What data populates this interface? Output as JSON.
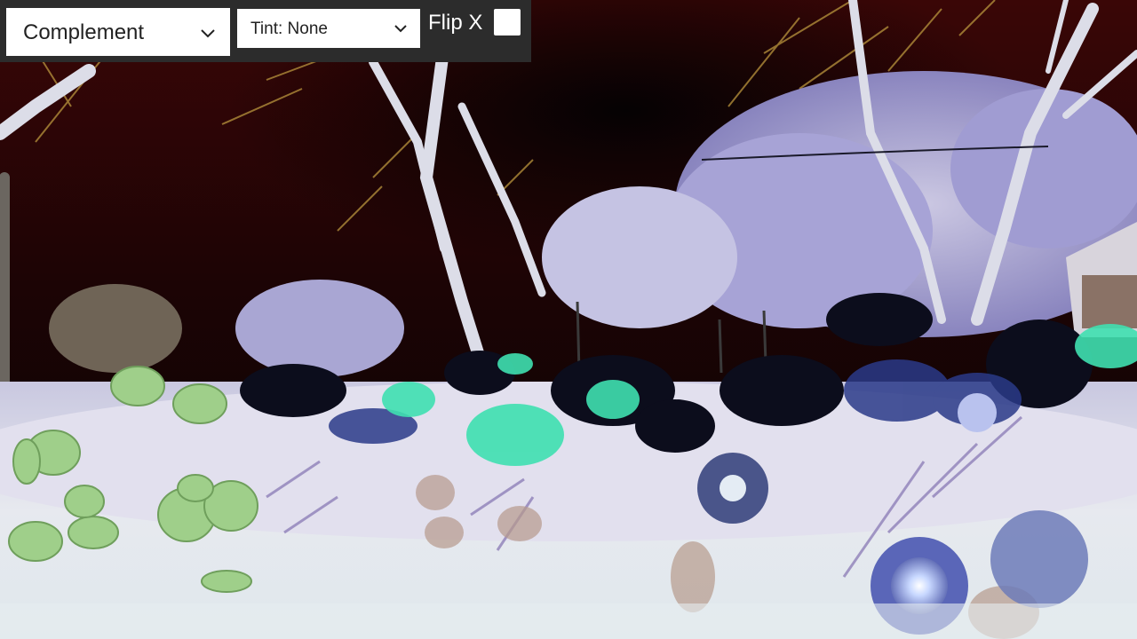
{
  "controls": {
    "effect_select": {
      "selected": "Complement",
      "icon": "chevron-down-icon"
    },
    "tint_select": {
      "selected": "Tint: None",
      "icon": "chevron-down-icon"
    },
    "flip_x": {
      "label": "Flip X",
      "checked": false
    }
  },
  "colors": {
    "toolbar_bg": "#2c2c2c",
    "control_bg": "#ffffff",
    "sky": "#3a0606",
    "sky_dark": "#070203",
    "foliage_lavender": "#a9a4d9",
    "foliage_white": "#e6e8f0",
    "accent_teal": "#3fe0b0",
    "leaf_green": "#9fcf8a",
    "flower_blue": "#5a66b8"
  }
}
